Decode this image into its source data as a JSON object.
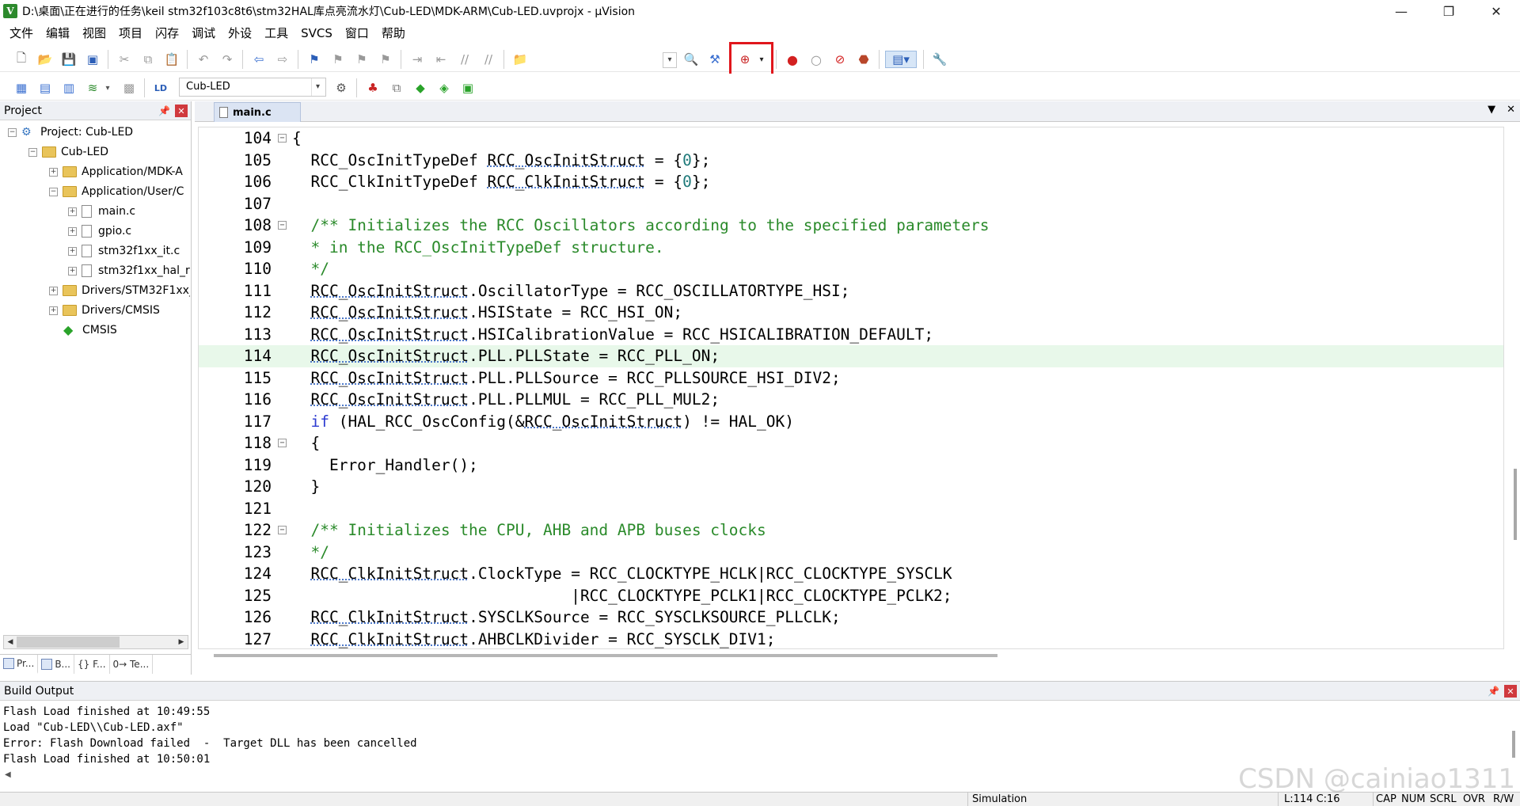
{
  "window": {
    "title": "D:\\桌面\\正在进行的任务\\keil stm32f103c8t6\\stm32HAL库点亮流水灯\\Cub-LED\\MDK-ARM\\Cub-LED.uvprojx - µVision",
    "minimize": "—",
    "maximize": "❐",
    "close": "✕"
  },
  "menu": [
    "文件",
    "编辑",
    "视图",
    "项目",
    "闪存",
    "调试",
    "外设",
    "工具",
    "SVCS",
    "窗口",
    "帮助"
  ],
  "toolbar": {
    "target_name": "Cub-LED",
    "highlighted_button": "debug-start-stop-icon"
  },
  "project_panel": {
    "title": "Project",
    "tree": [
      {
        "label": "Project: Cub-LED",
        "icon": "project-icon"
      },
      {
        "label": "Cub-LED",
        "icon": "folder-icon"
      },
      {
        "label": "Application/MDK-A",
        "icon": "folder-icon"
      },
      {
        "label": "Application/User/C",
        "icon": "folder-icon"
      },
      {
        "label": "main.c",
        "icon": "file-icon"
      },
      {
        "label": "gpio.c",
        "icon": "file-icon"
      },
      {
        "label": "stm32f1xx_it.c",
        "icon": "file-icon"
      },
      {
        "label": "stm32f1xx_hal_r",
        "icon": "file-icon"
      },
      {
        "label": "Drivers/STM32F1xx_",
        "icon": "folder-icon"
      },
      {
        "label": "Drivers/CMSIS",
        "icon": "folder-icon"
      },
      {
        "label": "CMSIS",
        "icon": "gem-icon"
      }
    ],
    "tabs": [
      "Pr...",
      "B...",
      "{} F...",
      "0→ Te..."
    ]
  },
  "editor": {
    "active_tab": "main.c",
    "lines": [
      {
        "n": "104",
        "text": "{"
      },
      {
        "n": "105",
        "text": "  RCC_OscInitTypeDef RCC_OscInitStruct = {0};"
      },
      {
        "n": "106",
        "text": "  RCC_ClkInitTypeDef RCC_ClkInitStruct = {0};"
      },
      {
        "n": "107",
        "text": ""
      },
      {
        "n": "108",
        "text": "  /** Initializes the RCC Oscillators according to the specified parameters"
      },
      {
        "n": "109",
        "text": "  * in the RCC_OscInitTypeDef structure."
      },
      {
        "n": "110",
        "text": "  */"
      },
      {
        "n": "111",
        "text": "  RCC_OscInitStruct.OscillatorType = RCC_OSCILLATORTYPE_HSI;"
      },
      {
        "n": "112",
        "text": "  RCC_OscInitStruct.HSIState = RCC_HSI_ON;"
      },
      {
        "n": "113",
        "text": "  RCC_OscInitStruct.HSICalibrationValue = RCC_HSICALIBRATION_DEFAULT;"
      },
      {
        "n": "114",
        "text": "  RCC_OscInitStruct.PLL.PLLState = RCC_PLL_ON;"
      },
      {
        "n": "115",
        "text": "  RCC_OscInitStruct.PLL.PLLSource = RCC_PLLSOURCE_HSI_DIV2;"
      },
      {
        "n": "116",
        "text": "  RCC_OscInitStruct.PLL.PLLMUL = RCC_PLL_MUL2;"
      },
      {
        "n": "117",
        "text": "  if (HAL_RCC_OscConfig(&RCC_OscInitStruct) != HAL_OK)"
      },
      {
        "n": "118",
        "text": "  {"
      },
      {
        "n": "119",
        "text": "    Error_Handler();"
      },
      {
        "n": "120",
        "text": "  }"
      },
      {
        "n": "121",
        "text": ""
      },
      {
        "n": "122",
        "text": "  /** Initializes the CPU, AHB and APB buses clocks"
      },
      {
        "n": "123",
        "text": "  */"
      },
      {
        "n": "124",
        "text": "  RCC_ClkInitStruct.ClockType = RCC_CLOCKTYPE_HCLK|RCC_CLOCKTYPE_SYSCLK"
      },
      {
        "n": "125",
        "text": "                              |RCC_CLOCKTYPE_PCLK1|RCC_CLOCKTYPE_PCLK2;"
      },
      {
        "n": "126",
        "text": "  RCC_ClkInitStruct.SYSCLKSource = RCC_SYSCLKSOURCE_PLLCLK;"
      },
      {
        "n": "127",
        "text": "  RCC_ClkInitStruct.AHBCLKDivider = RCC_SYSCLK_DIV1;"
      }
    ],
    "highlighted_line": "114"
  },
  "build_output": {
    "title": "Build Output",
    "lines": [
      "Flash Load finished at 10:49:55",
      "Load \"Cub-LED\\\\Cub-LED.axf\"",
      "Error: Flash Download failed  -  Target DLL has been cancelled",
      "Flash Load finished at 10:50:01"
    ]
  },
  "status_bar": {
    "mode": "Simulation",
    "position": "L:114 C:16",
    "cap": "CAP",
    "num": "NUM",
    "scrl": "SCRL",
    "ovr": "OVR",
    "rw": "R/W"
  },
  "watermark": "CSDN @cainiao1311",
  "colors": {
    "highlight_box": "#e0161c",
    "comment": "#2a8a2a",
    "keyword": "#2d3bd1",
    "current_line": "#e8f8ea"
  }
}
